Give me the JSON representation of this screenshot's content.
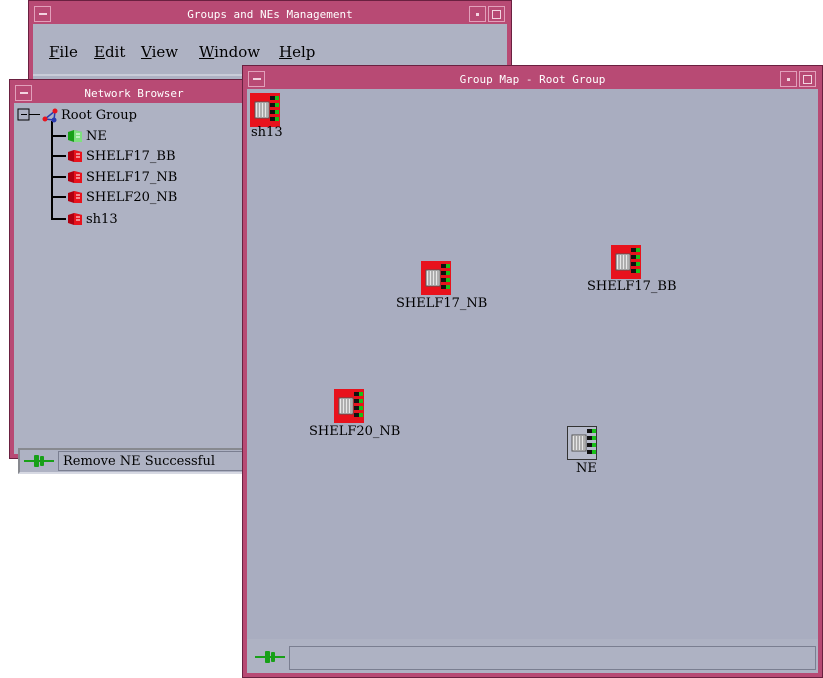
{
  "main_window": {
    "title": "Groups and NEs Management",
    "menu": [
      {
        "label": "File",
        "mnemonic": "F",
        "rest": "ile"
      },
      {
        "label": "Edit",
        "mnemonic": "E",
        "rest": "dit"
      },
      {
        "label": "View",
        "mnemonic": "V",
        "rest": "iew"
      },
      {
        "label": "Window",
        "mnemonic": "W",
        "rest": "indow"
      },
      {
        "label": "Help",
        "mnemonic": "H",
        "rest": "elp"
      }
    ]
  },
  "network_browser": {
    "title": "Network Browser",
    "tree": {
      "root": "Root Group",
      "children": [
        "NE",
        "SHELF17_BB",
        "SHELF17_NB",
        "SHELF20_NB",
        "sh13"
      ]
    },
    "status": "Remove NE Successful"
  },
  "group_map": {
    "title": "Group Map - Root Group",
    "nodes": {
      "sh13": "sh13",
      "shelf17_nb": "SHELF17_NB",
      "shelf17_bb": "SHELF17_BB",
      "shelf20_nb": "SHELF20_NB",
      "ne": "NE"
    },
    "status": ""
  },
  "colors": {
    "titlebar": "#b84a74",
    "background": "#aeb2c3",
    "map_background": "#a9adc0",
    "alarm_red": "#e8121c",
    "ok_green": "#18a018"
  }
}
